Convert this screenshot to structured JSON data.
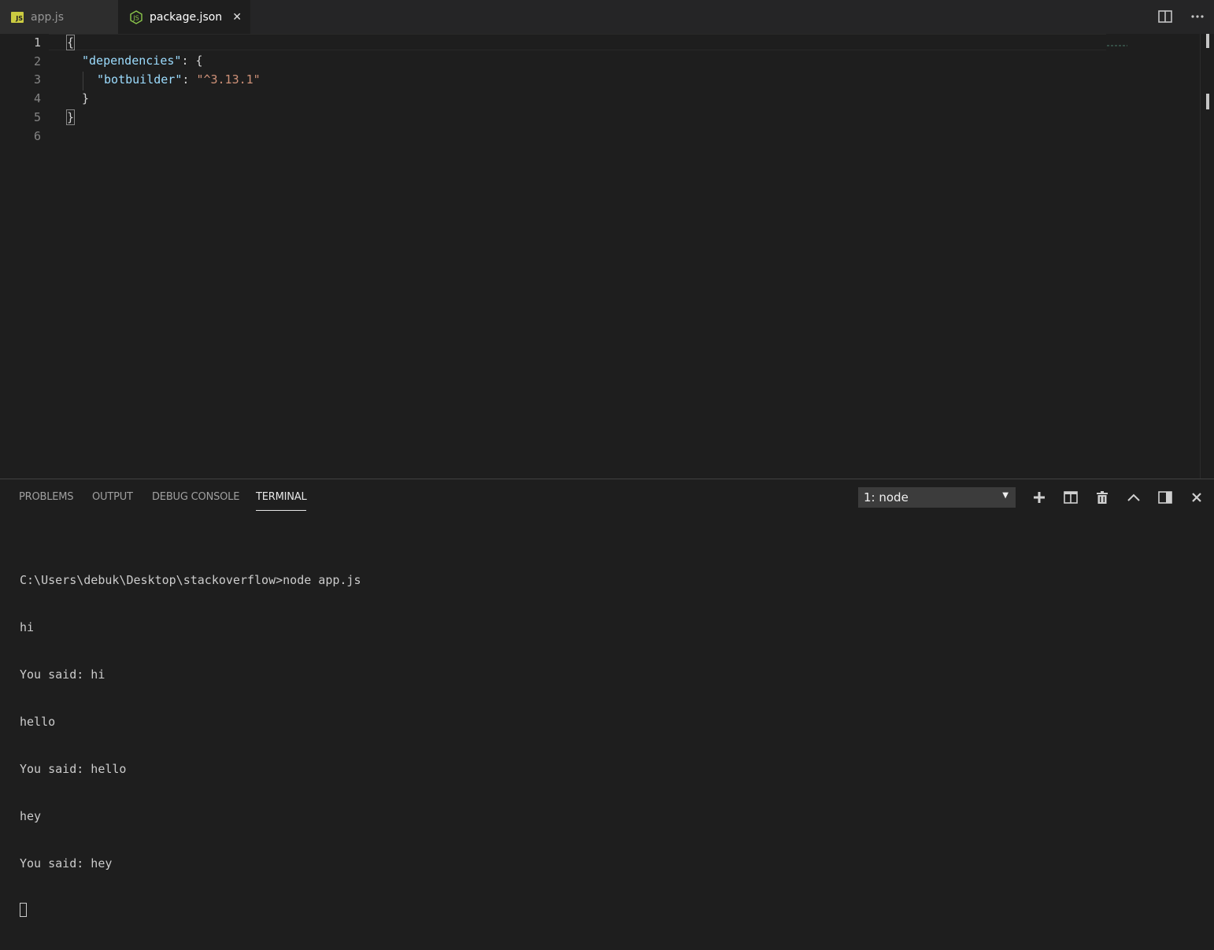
{
  "tabs": [
    {
      "label": "app.js",
      "icon": "js-file-icon",
      "active": false
    },
    {
      "label": "package.json",
      "icon": "nodejs-icon",
      "active": true,
      "close": "✕"
    }
  ],
  "editor": {
    "line_numbers": [
      "1",
      "2",
      "3",
      "4",
      "5",
      "6"
    ],
    "current_line": "1",
    "code": {
      "open_brace": "{",
      "dependencies_key": "\"dependencies\"",
      "colon": ": ",
      "inner_open": "{",
      "botbuilder_key": "\"botbuilder\"",
      "botbuilder_value": "\"^3.13.1\"",
      "inner_close": "}",
      "close_brace": "}"
    }
  },
  "panel": {
    "tabs": [
      "PROBLEMS",
      "OUTPUT",
      "DEBUG CONSOLE",
      "TERMINAL"
    ],
    "active_tab": "TERMINAL",
    "terminal_select": "1: node",
    "terminal_lines": [
      "C:\\Users\\debuk\\Desktop\\stackoverflow>node app.js",
      "hi",
      "You said: hi",
      "hello",
      "You said: hello",
      "hey",
      "You said: hey"
    ]
  },
  "colors": {
    "background": "#1e1e1e",
    "json_key": "#9cdcfe",
    "json_string": "#ce9178",
    "js_icon": "#cbcb41",
    "node_icon": "#8cc84b"
  }
}
